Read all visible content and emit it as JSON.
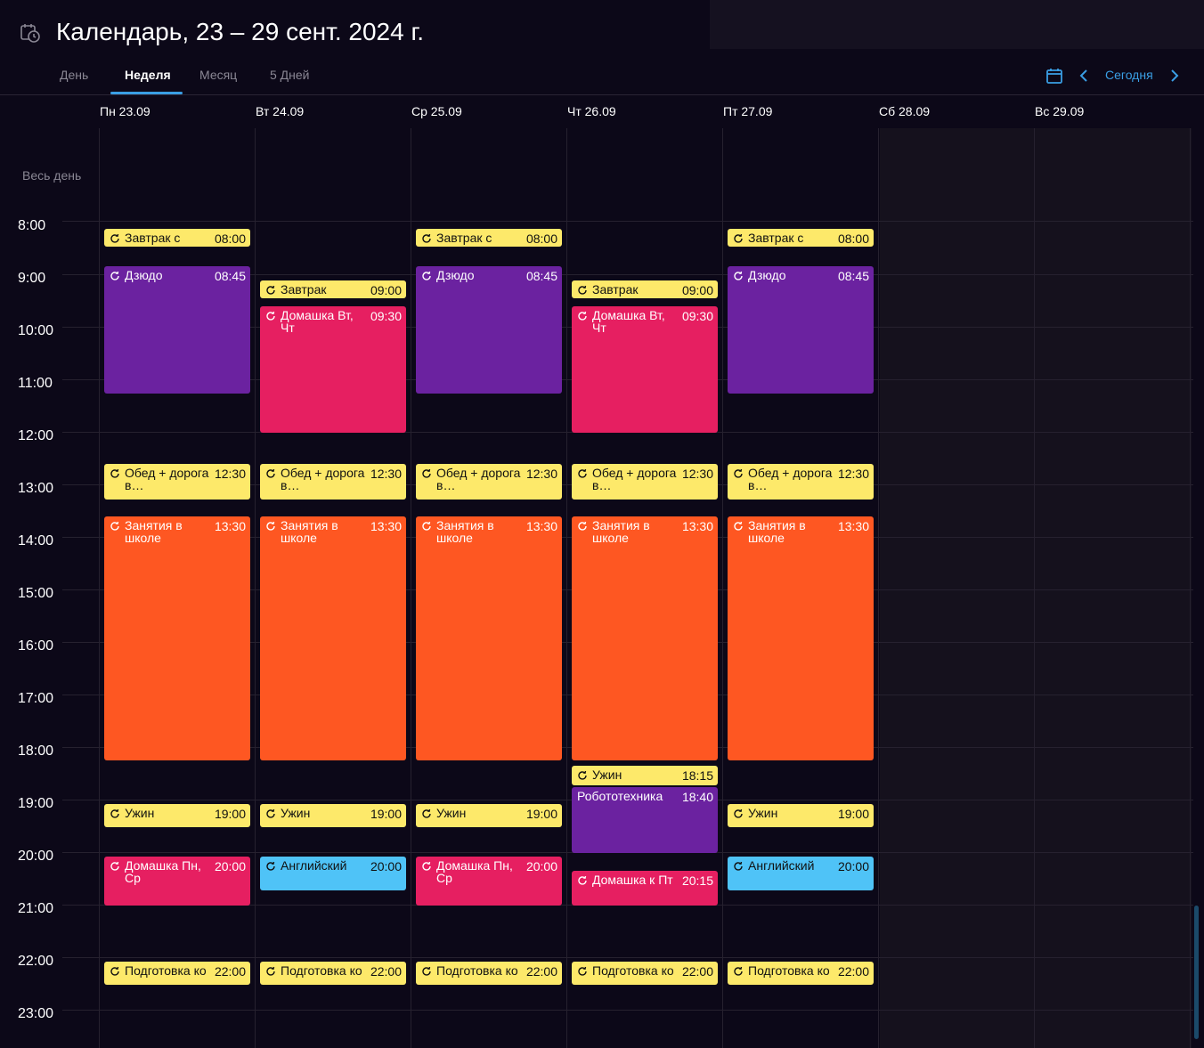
{
  "header": {
    "title": "Календарь, 23 – 29 сент. 2024 г.",
    "tabs": [
      "День",
      "Неделя",
      "Месяц",
      "5 Дней"
    ],
    "active_tab": "Неделя",
    "today_label": "Сегодня",
    "accent_color": "#3a9ee4"
  },
  "allday_label": "Весь день",
  "days": [
    "Пн 23.09",
    "Вт 24.09",
    "Ср 25.09",
    "Чт 26.09",
    "Пт 27.09",
    "Сб 28.09",
    "Вс 29.09"
  ],
  "hours": [
    "8:00",
    "9:00",
    "10:00",
    "11:00",
    "12:00",
    "13:00",
    "14:00",
    "15:00",
    "16:00",
    "17:00",
    "18:00",
    "19:00",
    "20:00",
    "21:00",
    "22:00",
    "23:00"
  ],
  "colors": {
    "yellow": "#fde96a",
    "purple": "#6b22a0",
    "pink": "#e61f61",
    "orange": "#fe5722",
    "blue": "#4fc3f7"
  },
  "events": [
    {
      "day": 0,
      "title": "Завтрак с",
      "time": "08:00",
      "color": "yellow",
      "recurring": true
    },
    {
      "day": 0,
      "title": "Дзюдо",
      "time": "08:45",
      "color": "purple",
      "recurring": true
    },
    {
      "day": 0,
      "title": "Обед + дорога в…",
      "time": "12:30",
      "color": "yellow",
      "recurring": true
    },
    {
      "day": 0,
      "title": "Занятия в школе",
      "time": "13:30",
      "color": "orange",
      "recurring": true
    },
    {
      "day": 0,
      "title": "Ужин",
      "time": "19:00",
      "color": "yellow",
      "recurring": true
    },
    {
      "day": 0,
      "title": "Домашка Пн, Ср",
      "time": "20:00",
      "color": "pink",
      "recurring": true
    },
    {
      "day": 0,
      "title": "Подготовка ко",
      "time": "22:00",
      "color": "yellow",
      "recurring": true
    },
    {
      "day": 1,
      "title": "Завтрак",
      "time": "09:00",
      "color": "yellow",
      "recurring": true
    },
    {
      "day": 1,
      "title": "Домашка Вт, Чт",
      "time": "09:30",
      "color": "pink",
      "recurring": true
    },
    {
      "day": 1,
      "title": "Обед + дорога в…",
      "time": "12:30",
      "color": "yellow",
      "recurring": true
    },
    {
      "day": 1,
      "title": "Занятия в школе",
      "time": "13:30",
      "color": "orange",
      "recurring": true
    },
    {
      "day": 1,
      "title": "Ужин",
      "time": "19:00",
      "color": "yellow",
      "recurring": true
    },
    {
      "day": 1,
      "title": "Английский",
      "time": "20:00",
      "color": "blue",
      "recurring": true
    },
    {
      "day": 1,
      "title": "Подготовка ко",
      "time": "22:00",
      "color": "yellow",
      "recurring": true
    },
    {
      "day": 2,
      "title": "Завтрак с",
      "time": "08:00",
      "color": "yellow",
      "recurring": true
    },
    {
      "day": 2,
      "title": "Дзюдо",
      "time": "08:45",
      "color": "purple",
      "recurring": true
    },
    {
      "day": 2,
      "title": "Обед + дорога в…",
      "time": "12:30",
      "color": "yellow",
      "recurring": true
    },
    {
      "day": 2,
      "title": "Занятия в школе",
      "time": "13:30",
      "color": "orange",
      "recurring": true
    },
    {
      "day": 2,
      "title": "Ужин",
      "time": "19:00",
      "color": "yellow",
      "recurring": true
    },
    {
      "day": 2,
      "title": "Домашка Пн, Ср",
      "time": "20:00",
      "color": "pink",
      "recurring": true
    },
    {
      "day": 2,
      "title": "Подготовка ко",
      "time": "22:00",
      "color": "yellow",
      "recurring": true
    },
    {
      "day": 3,
      "title": "Завтрак",
      "time": "09:00",
      "color": "yellow",
      "recurring": true
    },
    {
      "day": 3,
      "title": "Домашка Вт, Чт",
      "time": "09:30",
      "color": "pink",
      "recurring": true
    },
    {
      "day": 3,
      "title": "Обед + дорога в…",
      "time": "12:30",
      "color": "yellow",
      "recurring": true
    },
    {
      "day": 3,
      "title": "Занятия в школе",
      "time": "13:30",
      "color": "orange",
      "recurring": true
    },
    {
      "day": 3,
      "title": "Ужин",
      "time": "18:15",
      "color": "yellow",
      "recurring": true
    },
    {
      "day": 3,
      "title": "Робототехника",
      "time": "18:40",
      "color": "purple",
      "recurring": false
    },
    {
      "day": 3,
      "title": "Домашка к Пт",
      "time": "20:15",
      "color": "pink",
      "recurring": true
    },
    {
      "day": 3,
      "title": "Подготовка ко",
      "time": "22:00",
      "color": "yellow",
      "recurring": true
    },
    {
      "day": 4,
      "title": "Завтрак с",
      "time": "08:00",
      "color": "yellow",
      "recurring": true
    },
    {
      "day": 4,
      "title": "Дзюдо",
      "time": "08:45",
      "color": "purple",
      "recurring": true
    },
    {
      "day": 4,
      "title": "Обед + дорога в…",
      "time": "12:30",
      "color": "yellow",
      "recurring": true
    },
    {
      "day": 4,
      "title": "Занятия в школе",
      "time": "13:30",
      "color": "orange",
      "recurring": true
    },
    {
      "day": 4,
      "title": "Ужин",
      "time": "19:00",
      "color": "yellow",
      "recurring": true
    },
    {
      "day": 4,
      "title": "Английский",
      "time": "20:00",
      "color": "blue",
      "recurring": true
    },
    {
      "day": 4,
      "title": "Подготовка ко",
      "time": "22:00",
      "color": "yellow",
      "recurring": true
    }
  ]
}
